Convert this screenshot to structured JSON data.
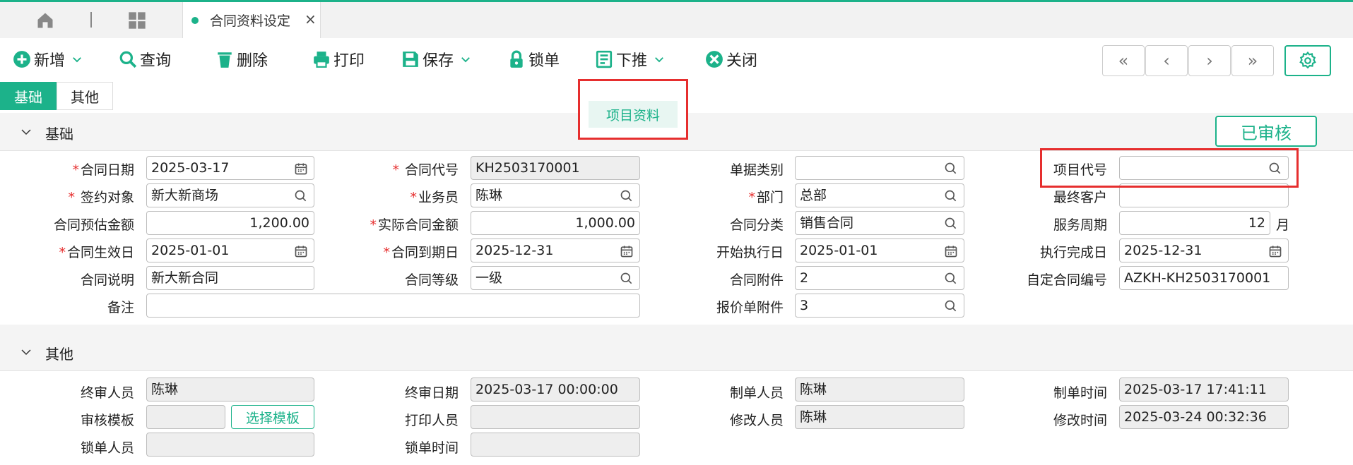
{
  "tabs": {
    "active_label": "合同资料设定",
    "close_symbol": "×"
  },
  "toolbar": {
    "new": "新增",
    "query": "查询",
    "delete": "删除",
    "print": "打印",
    "save": "保存",
    "lock": "锁单",
    "push": "下推",
    "close": "关闭"
  },
  "nav": {
    "first": "«",
    "prev": "‹",
    "next": "›",
    "last": "»"
  },
  "dropdown": {
    "item": "项目资料"
  },
  "subtabs": {
    "basic": "基础",
    "other": "其他"
  },
  "sections": {
    "basic": "基础",
    "other": "其他"
  },
  "status": "已审核",
  "form": {
    "contract_date": {
      "label": "合同日期",
      "value": "2025-03-17"
    },
    "contract_code": {
      "label": "合同代号",
      "value": "KH2503170001"
    },
    "doc_type": {
      "label": "单据类别",
      "value": ""
    },
    "project_code": {
      "label": "项目代号",
      "value": ""
    },
    "sign_party": {
      "label": "签约对象",
      "value": "新大新商场"
    },
    "salesman": {
      "label": "业务员",
      "value": "陈琳"
    },
    "dept": {
      "label": "部门",
      "value": "总部"
    },
    "end_customer": {
      "label": "最终客户",
      "value": ""
    },
    "est_amount": {
      "label": "合同预估金额",
      "value": "1,200.00"
    },
    "actual_amount": {
      "label": "实际合同金额",
      "value": "1,000.00"
    },
    "category": {
      "label": "合同分类",
      "value": "销售合同"
    },
    "service_period": {
      "label": "服务周期",
      "value": "12",
      "unit": "月"
    },
    "effective_date": {
      "label": "合同生效日",
      "value": "2025-01-01"
    },
    "expire_date": {
      "label": "合同到期日",
      "value": "2025-12-31"
    },
    "start_date": {
      "label": "开始执行日",
      "value": "2025-01-01"
    },
    "finish_date": {
      "label": "执行完成日",
      "value": "2025-12-31"
    },
    "description": {
      "label": "合同说明",
      "value": "新大新合同"
    },
    "level": {
      "label": "合同等级",
      "value": "一级"
    },
    "attachment": {
      "label": "合同附件",
      "value": "2"
    },
    "custom_no": {
      "label": "自定合同编号",
      "value": "AZKH-KH2503170001"
    },
    "remark": {
      "label": "备注",
      "value": ""
    },
    "quote_attachment": {
      "label": "报价单附件",
      "value": "3"
    }
  },
  "other": {
    "final_reviewer": {
      "label": "终审人员",
      "value": "陈琳"
    },
    "final_date": {
      "label": "终审日期",
      "value": "2025-03-17 00:00:00"
    },
    "creator": {
      "label": "制单人员",
      "value": "陈琳"
    },
    "create_time": {
      "label": "制单时间",
      "value": "2025-03-17 17:41:11"
    },
    "review_template": {
      "label": "审核模板",
      "value": "",
      "button": "选择模板"
    },
    "printer": {
      "label": "打印人员",
      "value": ""
    },
    "modifier": {
      "label": "修改人员",
      "value": "陈琳"
    },
    "modify_time": {
      "label": "修改时间",
      "value": "2025-03-24 00:32:36"
    },
    "locker": {
      "label": "锁单人员",
      "value": ""
    },
    "lock_time": {
      "label": "锁单时间",
      "value": ""
    }
  },
  "colors": {
    "accent": "#1cb28a",
    "required": "#e62e2e",
    "highlight": "#e62e2e"
  }
}
